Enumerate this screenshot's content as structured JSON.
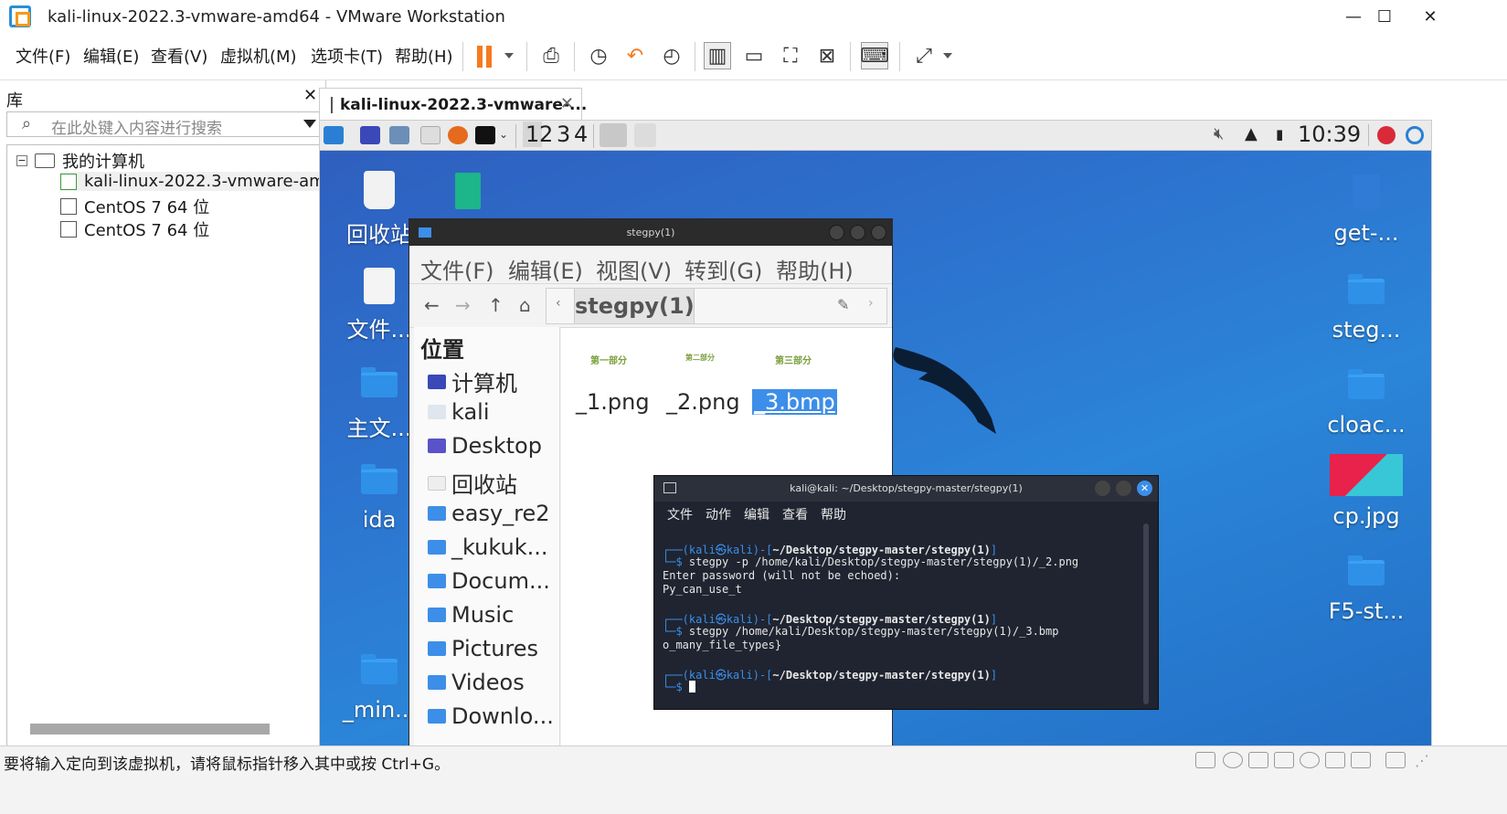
{
  "window": {
    "title": "kali-linux-2022.3-vmware-amd64 - VMware Workstation",
    "minimize": "—",
    "maximize": "☐",
    "close": "✕"
  },
  "menu": {
    "file": "文件(F)",
    "edit": "编辑(E)",
    "view": "查看(V)",
    "vm": "虚拟机(M)",
    "tabs": "选项卡(T)",
    "help": "帮助(H)"
  },
  "library": {
    "title": "库",
    "close": "✕",
    "search_placeholder": "在此处键入内容进行搜索",
    "tree": {
      "root": "我的计算机",
      "items": [
        "kali-linux-2022.3-vmware-amd64",
        "CentOS 7 64 位",
        "CentOS 7 64 位"
      ]
    }
  },
  "vm_tab": {
    "label": "kali-linux-2022.3-vmware-...",
    "close": "✕"
  },
  "kali_panel": {
    "workspaces": [
      "1",
      "2",
      "3",
      "4"
    ],
    "clock": "10:39"
  },
  "desktop": {
    "left_icons": [
      "回收站",
      "文件...",
      "主文...",
      "ida",
      "_min..."
    ],
    "right_icons": [
      "get-...",
      "steg...",
      "cloac...",
      "cp.jpg",
      "F5-st..."
    ]
  },
  "file_manager": {
    "title": "stegpy(1)",
    "menu": [
      "文件(F)",
      "编辑(E)",
      "视图(V)",
      "转到(G)",
      "帮助(H)"
    ],
    "path": "stegpy(1)",
    "places_title": "位置",
    "places": [
      "计算机",
      "kali",
      "Desktop",
      "回收站",
      "easy_re2",
      "_kukuk...",
      "Docum...",
      "Music",
      "Pictures",
      "Videos",
      "Downlo..."
    ],
    "files": [
      {
        "name": "_1.png",
        "thumb": "第一部分"
      },
      {
        "name": "_2.png",
        "thumb": "第二部分"
      },
      {
        "name": "_3.bmp",
        "thumb": "第三部分"
      }
    ]
  },
  "terminal": {
    "title": "kali@kali: ~/Desktop/stegpy-master/stegpy(1)",
    "menu": [
      "文件",
      "动作",
      "编辑",
      "查看",
      "帮助"
    ],
    "prompt_user": "kali",
    "prompt_host": "kali",
    "cwd": "~/Desktop/stegpy-master/stegpy(1)",
    "cmd1": "stegpy -p /home/kali/Desktop/stegpy-master/stegpy(1)/_2.png",
    "out1a": "Enter password (will not be echoed):",
    "out1b": "Py_can_use_t",
    "cmd2": "stegpy /home/kali/Desktop/stegpy-master/stegpy(1)/_3.bmp",
    "out2": "o_many_file_types}"
  },
  "statusbar": {
    "text": "要将输入定向到该虚拟机，请将鼠标指针移入其中或按 Ctrl+G。"
  },
  "colors": {
    "accent_orange": "#f57a1f",
    "vmware_blue": "#2a8fd6",
    "desktop_blue": "#2b85d8",
    "selection_blue": "#3d8ee8"
  }
}
